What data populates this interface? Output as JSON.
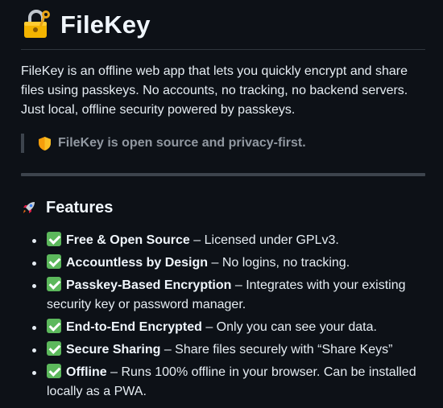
{
  "header": {
    "icon": "locked-with-key-icon",
    "title": "FileKey"
  },
  "intro": {
    "text": "FileKey is an offline web app that lets you quickly encrypt and share files using passkeys. No accounts, no tracking, no backend servers. Just local, offline security powered by passkeys."
  },
  "callout": {
    "icon": "shield-icon",
    "text": "FileKey is open source and privacy-first."
  },
  "features_section": {
    "icon": "rocket-icon",
    "title": "Features",
    "items": [
      {
        "icon": "check-mark-icon",
        "name": "Free & Open Source",
        "desc": " – Licensed under GPLv3."
      },
      {
        "icon": "check-mark-icon",
        "name": "Accountless by Design",
        "desc": " – No logins, no tracking."
      },
      {
        "icon": "check-mark-icon",
        "name": "Passkey-Based Encryption",
        "desc": " – Integrates with your existing security key or password manager."
      },
      {
        "icon": "check-mark-icon",
        "name": "End-to-End Encrypted",
        "desc": " – Only you can see your data."
      },
      {
        "icon": "check-mark-icon",
        "name": "Secure Sharing",
        "desc": " – Share files securely with “Share Keys”"
      },
      {
        "icon": "check-mark-icon",
        "name": "Offline",
        "desc": " – Runs 100% offline in your browser. Can be installed locally as a PWA."
      }
    ]
  },
  "colors": {
    "background": "#0d1117",
    "text": "#e6edf3",
    "muted": "#9198a1",
    "rule": "#3d444d",
    "check": "#5cb85c"
  }
}
